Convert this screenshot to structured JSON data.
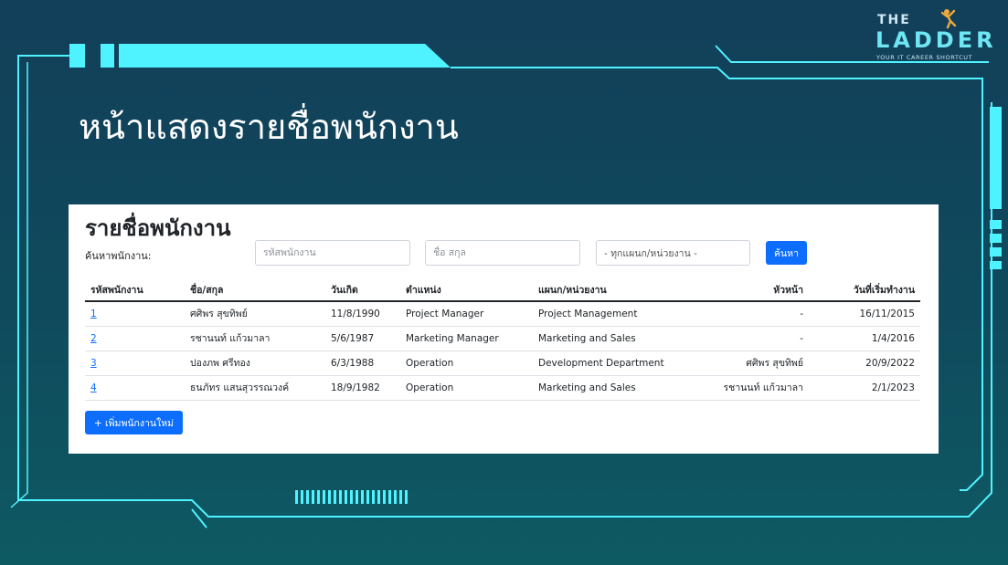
{
  "slide": {
    "title": "หน้าแสดงรายชื่อพนักงาน"
  },
  "logo": {
    "line1": "THE",
    "line2": "LADDER",
    "tagline": "YOUR IT CAREER SHORTCUT"
  },
  "page": {
    "title": "รายชื่อพนักงาน"
  },
  "search": {
    "label": "ค้นหาพนักงาน:",
    "id_placeholder": "รหัสพนักงาน",
    "name_placeholder": "ชื่อ สกุล",
    "department_selected": "- ทุกแผนก/หน่วยงาน -",
    "button_label": "ค้นหา"
  },
  "table": {
    "headers": [
      "รหัสพนักงาน",
      "ชื่อ/สกุล",
      "วันเกิด",
      "ตำแหน่ง",
      "แผนก/หน่วยงาน",
      "หัวหน้า",
      "วันที่เริ่มทำงาน"
    ],
    "rows": [
      {
        "id": "1",
        "name": "ศศิพร สุขทิพย์",
        "birthdate": "11/8/1990",
        "position": "Project Manager",
        "department": "Project Management",
        "manager": "-",
        "start_date": "16/11/2015"
      },
      {
        "id": "2",
        "name": "รชานนท์ แก้วมาลา",
        "birthdate": "5/6/1987",
        "position": "Marketing Manager",
        "department": "Marketing and Sales",
        "manager": "-",
        "start_date": "1/4/2016"
      },
      {
        "id": "3",
        "name": "ปองภพ ศรีทอง",
        "birthdate": "6/3/1988",
        "position": "Operation",
        "department": "Development Department",
        "manager": "ศศิพร สุขทิพย์",
        "start_date": "20/9/2022"
      },
      {
        "id": "4",
        "name": "ธนภัทร แสนสุวรรณวงค์",
        "birthdate": "18/9/1982",
        "position": "Operation",
        "department": "Marketing and Sales",
        "manager": "รชานนท์ แก้วมาลา",
        "start_date": "2/1/2023"
      }
    ]
  },
  "actions": {
    "add_label": "+ เพิ่มพนักงานใหม่"
  },
  "colors": {
    "background": "#123f5a",
    "frame_cyan": "#4ff3ff",
    "primary_button": "#0d6efd"
  }
}
